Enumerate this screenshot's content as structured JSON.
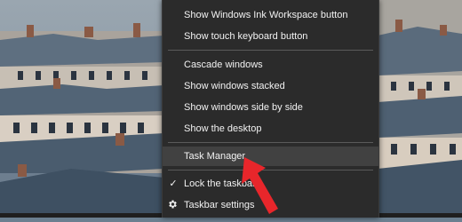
{
  "context_menu": {
    "items": [
      {
        "label": "Show Windows Ink Workspace button"
      },
      {
        "label": "Show touch keyboard button"
      },
      {
        "label": "Cascade windows"
      },
      {
        "label": "Show windows stacked"
      },
      {
        "label": "Show windows side by side"
      },
      {
        "label": "Show the desktop"
      },
      {
        "label": "Task Manager"
      },
      {
        "label": "Lock the taskbar",
        "checked": true
      },
      {
        "label": "Taskbar settings",
        "icon": "gear-icon"
      }
    ],
    "highlighted_item": "Task Manager"
  },
  "annotation": {
    "icon": "arrow-pointer-icon",
    "color": "#e8262b"
  },
  "colors": {
    "menu_bg": "#2b2b2b",
    "menu_hover": "#414141",
    "menu_text": "#f2f2f2"
  }
}
